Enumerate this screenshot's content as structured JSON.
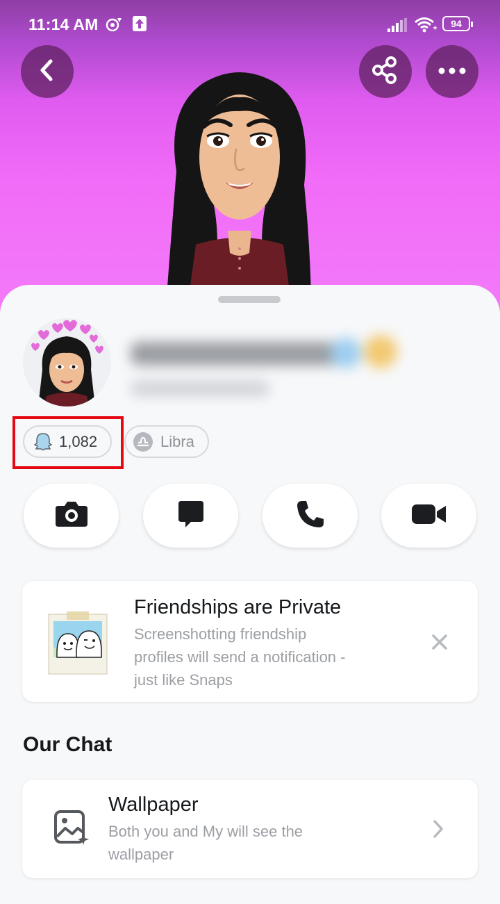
{
  "status_bar": {
    "time": "11:14 AM",
    "battery": "94"
  },
  "profile": {
    "snap_score": "1,082",
    "zodiac": "Libra"
  },
  "actions": [
    {
      "name": "camera-button",
      "icon": "camera-icon"
    },
    {
      "name": "chat-button",
      "icon": "chat-bubble-icon"
    },
    {
      "name": "call-button",
      "icon": "phone-icon"
    },
    {
      "name": "video-call-button",
      "icon": "video-camera-icon"
    }
  ],
  "privacy_card": {
    "title": "Friendships are Private",
    "body_lines": [
      "Screenshotting friendship",
      "profiles will send a notification -",
      "just like Snaps"
    ]
  },
  "chat_section": {
    "title": "Our Chat",
    "wallpaper": {
      "title": "Wallpaper",
      "body_lines": [
        "Both you and My will see the",
        "wallpaper"
      ]
    }
  },
  "colors": {
    "hero_top": "#8e3fa6",
    "hero_bottom": "#f37bf9",
    "highlight": "#e50914",
    "sheet": "#f7f8fa"
  }
}
